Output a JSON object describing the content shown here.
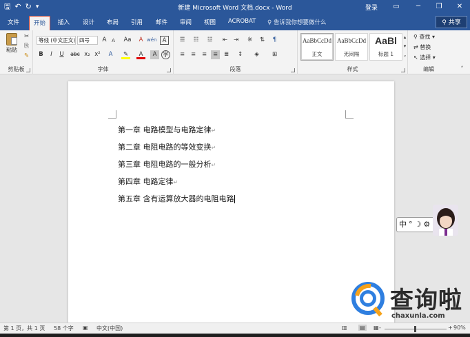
{
  "window": {
    "title": "新建 Microsoft Word 文档.docx - Word",
    "login": "登录",
    "quick_access": [
      "save-icon",
      "undo-icon",
      "redo-icon",
      "customize-icon"
    ]
  },
  "tabs": [
    "文件",
    "开始",
    "插入",
    "设计",
    "布局",
    "引用",
    "邮件",
    "审阅",
    "视图",
    "ACROBAT"
  ],
  "active_tab": "开始",
  "tellme": "告诉我你想要做什么",
  "share": "共享",
  "ribbon": {
    "clipboard": {
      "label": "剪贴板",
      "paste": "粘贴"
    },
    "font": {
      "label": "字体",
      "font_name": "等线 (中文正文)",
      "font_size": "四号",
      "bold": "B",
      "italic": "I",
      "underline": "U",
      "strike": "abc",
      "subscript": "x₂",
      "superscript": "x²",
      "grow": "A",
      "shrink": "A",
      "case": "Aa",
      "clear": "A",
      "phonetic": "wén",
      "border_char": "A"
    },
    "paragraph": {
      "label": "段落"
    },
    "styles": {
      "label": "样式",
      "items": [
        {
          "preview": "AaBbCcDd",
          "name": "正文"
        },
        {
          "preview": "AaBbCcDd",
          "name": "无间隔"
        },
        {
          "preview": "AaBl",
          "name": "标题 1"
        }
      ]
    },
    "editing": {
      "label": "编辑",
      "find": "查找",
      "replace": "替换",
      "select": "选择"
    }
  },
  "document": {
    "lines": [
      "第一章  电路模型与电路定律",
      "第二章  电阻电路的等效变换",
      "第三章  电阻电路的一般分析",
      "第四章  电路定律",
      "第五章  含有运算放大器的电阻电路"
    ],
    "paragraph_mark": "↵"
  },
  "ime": {
    "mode": "中",
    "punct": "°",
    "moon": "☽",
    "gear": "⚙"
  },
  "status": {
    "page": "第 1 页，共 1 页",
    "words": "58 个字",
    "language": "中文(中国)",
    "zoom": "90%"
  },
  "watermark": {
    "text": "查询啦",
    "url": "chaxunla.com"
  }
}
